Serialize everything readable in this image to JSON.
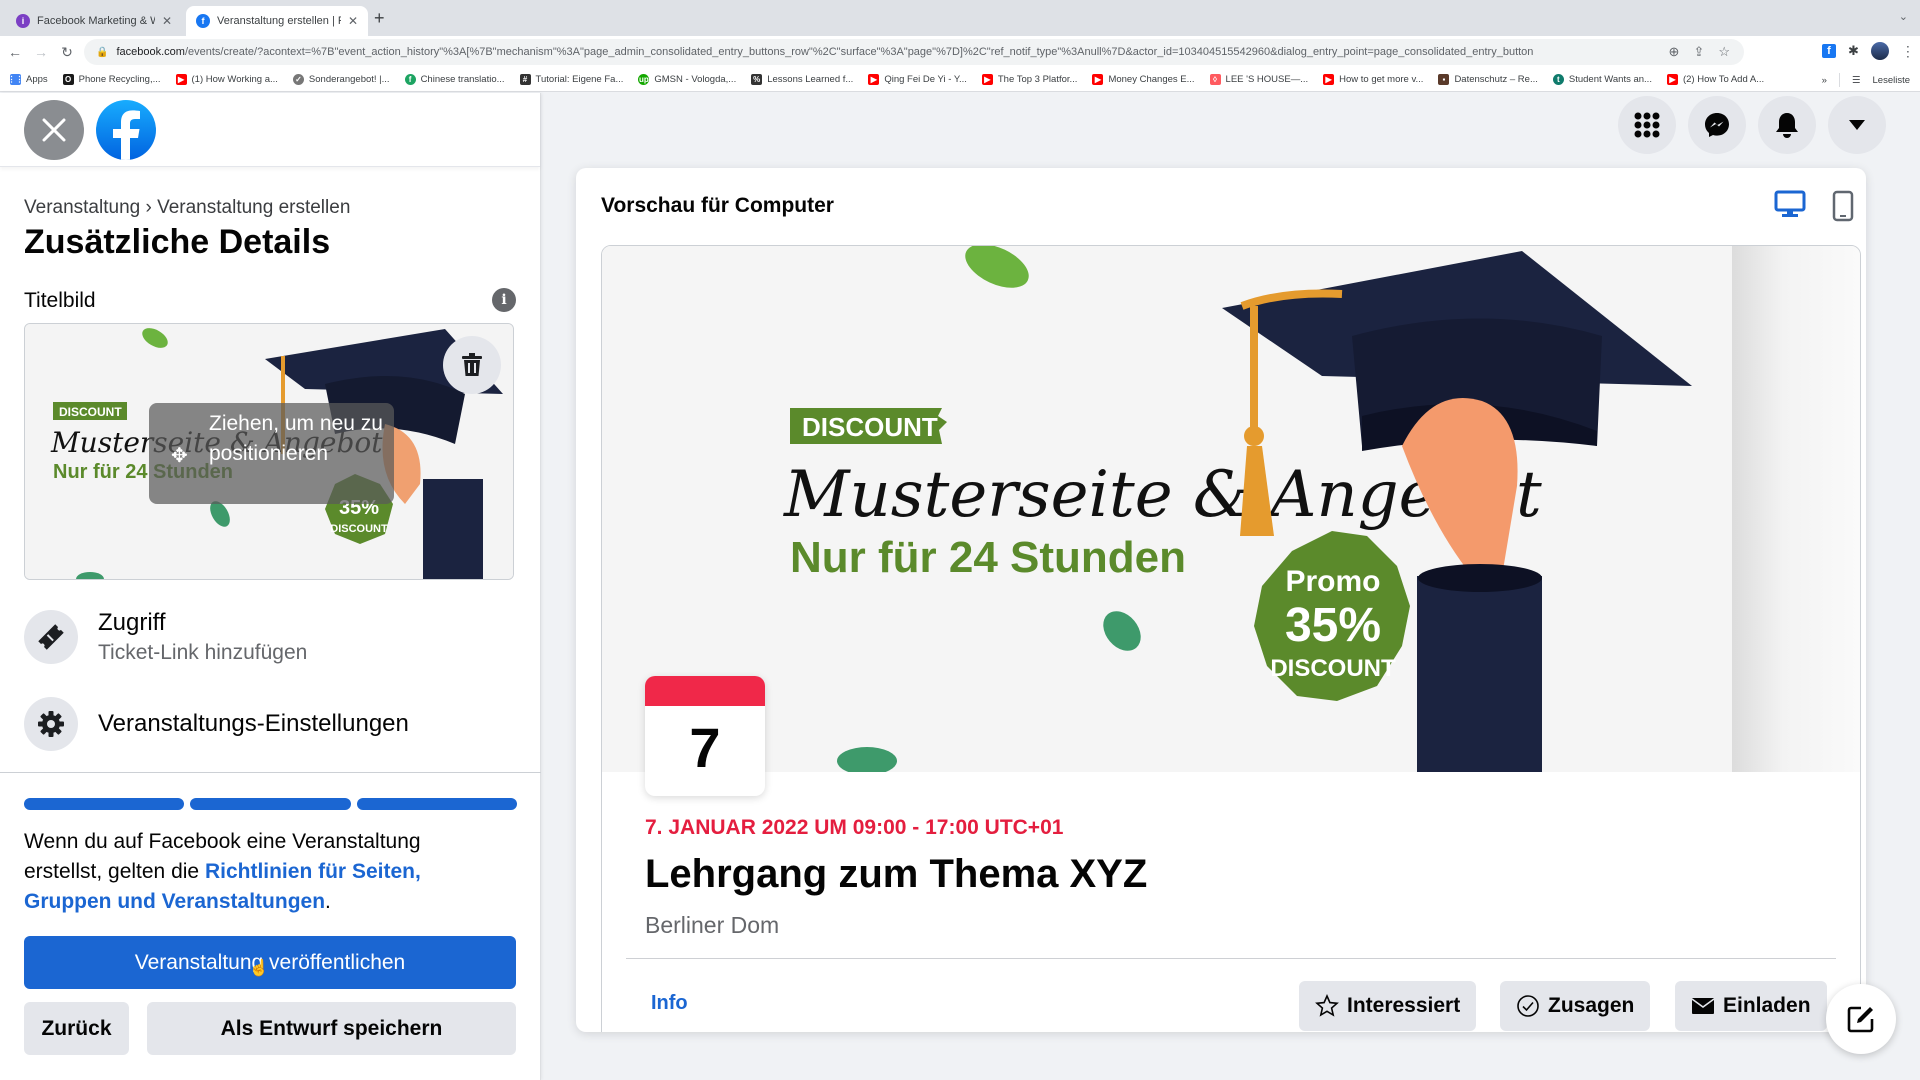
{
  "browser": {
    "tabs": [
      {
        "label": "Facebook Marketing & Werbea",
        "active": false,
        "favicon": "purple-circle-icon"
      },
      {
        "label": "Veranstaltung erstellen | Faceb",
        "active": true,
        "favicon": "facebook-icon"
      }
    ],
    "new_tab_label": "+",
    "url_host": "facebook.com",
    "url_path": "/events/create/?acontext=%7B\"event_action_history\"%3A[%7B\"mechanism\"%3A\"page_admin_consolidated_entry_buttons_row\"%2C\"surface\"%3A\"page\"%7D]%2C\"ref_notif_type\"%3Anull%7D&actor_id=103404515542960&dialog_entry_point=page_consolidated_entry_button",
    "bookmarks": [
      {
        "label": "Apps",
        "icon": "apps-grid-icon",
        "color": "#4285f4"
      },
      {
        "label": "Phone Recycling,...",
        "icon": "o2-icon",
        "color": "#1a1a1a"
      },
      {
        "label": "(1) How Working a...",
        "icon": "youtube-icon",
        "color": "#ff0000"
      },
      {
        "label": "Sonderangebot! |...",
        "icon": "check-badge-icon",
        "color": "#777777"
      },
      {
        "label": "Chinese translatio...",
        "icon": "green-circle-icon",
        "color": "#1da462"
      },
      {
        "label": "Tutorial: Eigene Fa...",
        "icon": "hash-icon",
        "color": "#333333"
      },
      {
        "label": "GMSN - Vologda,...",
        "icon": "upwork-icon",
        "color": "#14a800"
      },
      {
        "label": "Lessons Learned f...",
        "icon": "percent-icon",
        "color": "#333333"
      },
      {
        "label": "Qing Fei De Yi - Y...",
        "icon": "youtube-icon",
        "color": "#ff0000"
      },
      {
        "label": "The Top 3 Platfor...",
        "icon": "youtube-icon",
        "color": "#ff0000"
      },
      {
        "label": "Money Changes E...",
        "icon": "youtube-icon",
        "color": "#ff0000"
      },
      {
        "label": "LEE 'S HOUSE—...",
        "icon": "airbnb-icon",
        "color": "#ff5a5f"
      },
      {
        "label": "How to get more v...",
        "icon": "youtube-icon",
        "color": "#ff0000"
      },
      {
        "label": "Datenschutz – Re...",
        "icon": "image-thumb-icon",
        "color": "#5a3a2a"
      },
      {
        "label": "Student Wants an...",
        "icon": "t-circle-icon",
        "color": "#0f7b6c"
      },
      {
        "label": "(2) How To Add A...",
        "icon": "youtube-icon",
        "color": "#ff0000"
      }
    ],
    "overflow_label": "»",
    "reading_list_label": "Leseliste"
  },
  "left_panel": {
    "breadcrumb": {
      "parent": "Veranstaltung",
      "separator": "›",
      "current": "Veranstaltung erstellen"
    },
    "title": "Zusätzliche Details",
    "cover_section_label": "Titelbild",
    "cover_drag_hint": "Ziehen, um neu zu positionieren",
    "options": [
      {
        "title": "Zugriff",
        "subtitle": "Ticket-Link hinzufügen",
        "icon": "ticket-icon"
      },
      {
        "title": "Veranstaltungs-Einstellungen",
        "subtitle": "",
        "icon": "gear-icon"
      }
    ],
    "progress": {
      "steps_total": 3,
      "steps_completed": 3
    },
    "terms_prefix": "Wenn du auf Facebook eine Veranstaltung erstellst, gelten die ",
    "terms_link": "Richtlinien für Seiten, Gruppen und Veranstaltungen",
    "terms_suffix": ".",
    "publish_label": "Veranstaltung veröffentlichen",
    "back_label": "Zurück",
    "draft_label": "Als Entwurf speichern"
  },
  "preview": {
    "title": "Vorschau für Computer",
    "device_selected": "desktop",
    "cover_image": {
      "badge": "DISCOUNT",
      "headline": "Musterseite & Angebot",
      "subline": "Nur für 24 Stunden",
      "promo_top": "Promo",
      "promo_value": "35%",
      "promo_bottom": "DISCOUNT"
    },
    "calendar_day": "7",
    "date_line": "7. JANUAR 2022 UM 09:00 - 17:00 UTC+01",
    "event_title": "Lehrgang zum Thema XYZ",
    "location": "Berliner Dom",
    "tab_info": "Info",
    "actions": [
      {
        "label": "Interessiert",
        "icon": "star-icon"
      },
      {
        "label": "Zusagen",
        "icon": "check-circle-icon"
      },
      {
        "label": "Einladen",
        "icon": "envelope-icon"
      }
    ]
  },
  "colors": {
    "fb_blue": "#1b66d2",
    "event_red": "#e41e3f",
    "promo_green": "#5b8a2b"
  }
}
